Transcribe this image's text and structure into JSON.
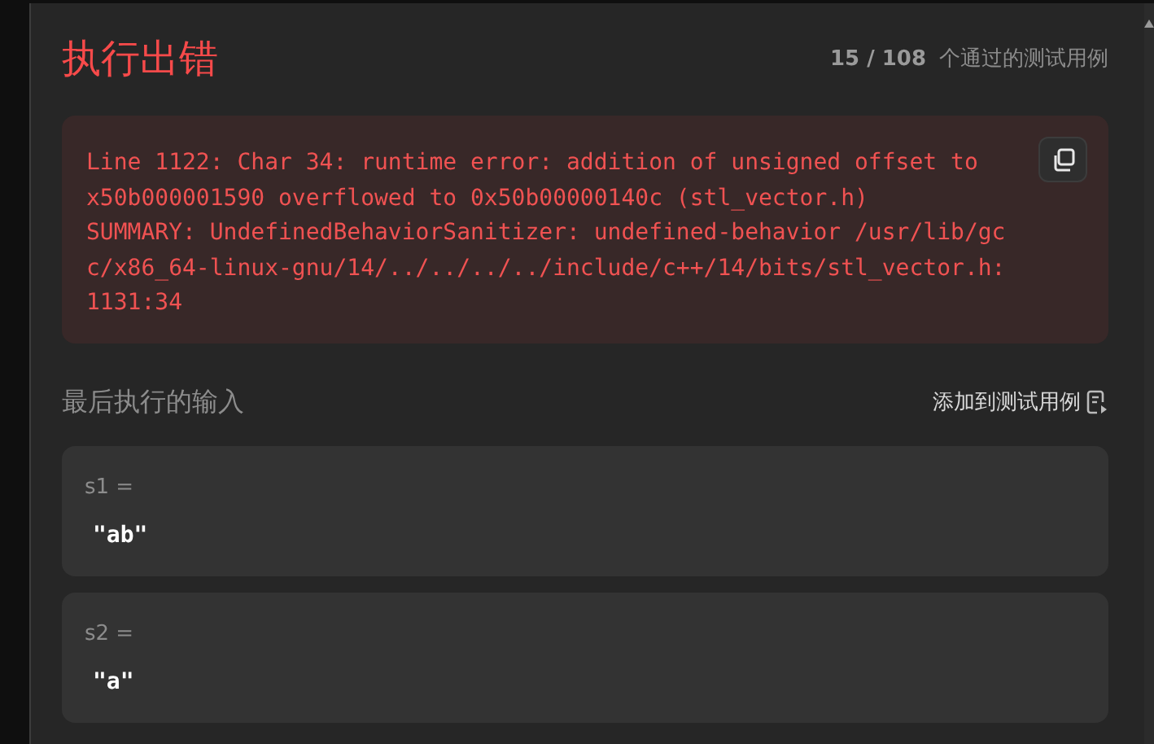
{
  "result": {
    "title": "执行出错",
    "passed": "15 / 108",
    "passed_label": "个通过的测试用例"
  },
  "error": {
    "lines": [
      "Line 1122: Char 34: runtime error: addition of unsigned offset to",
      "x50b000001590 overflowed to 0x50b00000140c (stl_vector.h)",
      "SUMMARY: UndefinedBehaviorSanitizer: undefined-behavior /usr/lib/gc",
      "c/x86_64-linux-gnu/14/../../../../include/c++/14/bits/stl_vector.h:",
      "1131:34"
    ]
  },
  "last_input": {
    "heading": "最后执行的输入",
    "add_button": "添加到测试用例",
    "params": [
      {
        "name": "s1 =",
        "value": "\"ab\""
      },
      {
        "name": "s2 =",
        "value": "\"a\""
      }
    ]
  }
}
